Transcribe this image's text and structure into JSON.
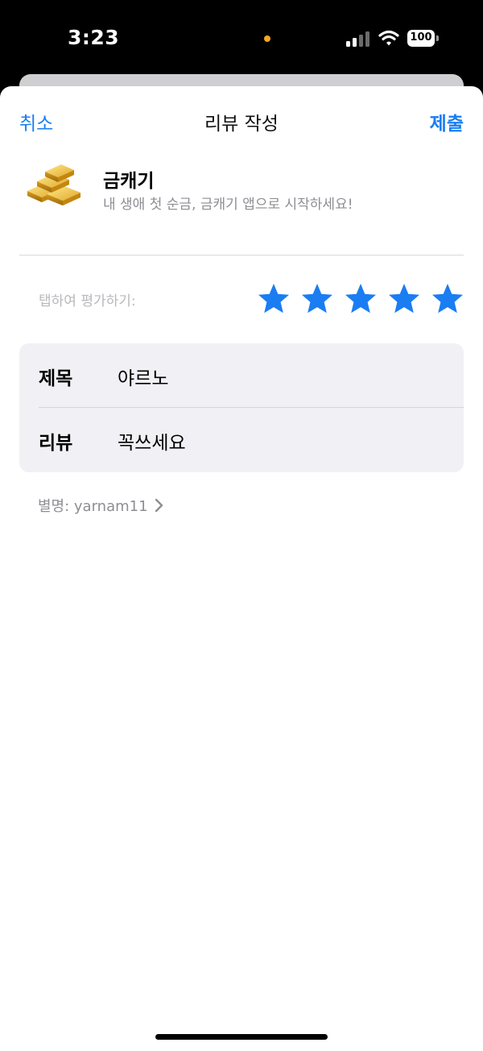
{
  "status_bar": {
    "time": "3:23",
    "battery": "100",
    "privacy_dot_color": "#f5a623",
    "icons": [
      "cellular-signal-icon",
      "wifi-icon",
      "battery-icon"
    ]
  },
  "nav": {
    "cancel_label": "취소",
    "title": "리뷰 작성",
    "submit_label": "제출"
  },
  "app": {
    "name": "금캐기",
    "subtitle": "내 생애 첫 순금, 금캐기 앱으로 시작하세요!",
    "icon": "gold-bars-icon"
  },
  "rating": {
    "label": "탭하여 평가하기:",
    "stars_selected": 5,
    "stars_total": 5,
    "star_color": "#1a7df2"
  },
  "form": {
    "title_label": "제목",
    "title_value": "야르노",
    "review_label": "리뷰",
    "review_value": "꼭쓰세요"
  },
  "nickname": {
    "text": "별명: yarnam11",
    "icon": "chevron-right-icon"
  },
  "colors": {
    "accent": "#1a7df2",
    "secondary_text": "#8e8e93"
  }
}
